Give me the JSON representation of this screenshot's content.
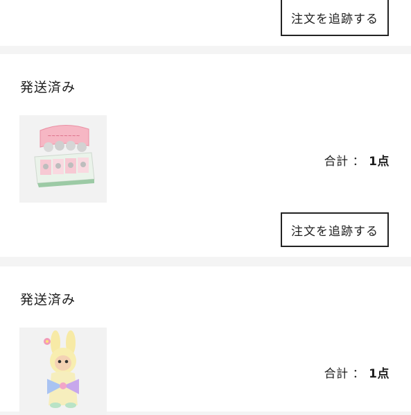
{
  "orders": [
    {
      "track_button": "注文を追跡する"
    },
    {
      "status": "発送済み",
      "image": "blind-box-display-set",
      "total_label": "合計",
      "total_sep": "：",
      "total_value": "1点",
      "track_button": "注文を追跡する"
    },
    {
      "status": "発送済み",
      "image": "bunny-doll-figure",
      "total_label": "合計",
      "total_sep": "：",
      "total_value": "1点"
    }
  ],
  "colors": {
    "page_bg": "#f4f4f4",
    "card_bg": "#ffffff",
    "text": "#1e1e1e",
    "border": "#222222"
  }
}
